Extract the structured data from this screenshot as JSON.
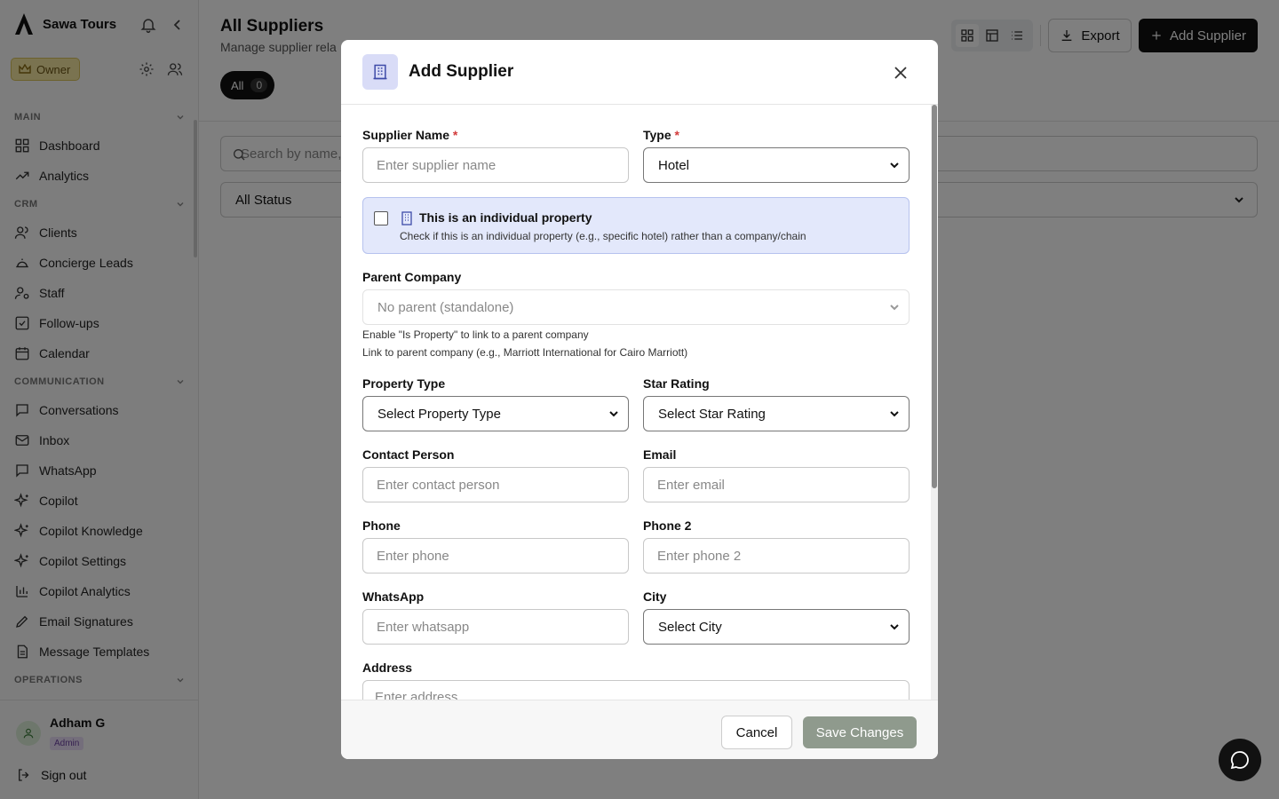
{
  "sidebar": {
    "brand": "Sawa Tours",
    "role_badge": "Owner",
    "sections": {
      "main": "MAIN",
      "crm": "CRM",
      "communication": "COMMUNICATION",
      "operations": "OPERATIONS"
    },
    "items": {
      "dashboard": "Dashboard",
      "analytics": "Analytics",
      "clients": "Clients",
      "concierge_leads": "Concierge Leads",
      "staff": "Staff",
      "follow_ups": "Follow-ups",
      "calendar": "Calendar",
      "conversations": "Conversations",
      "inbox": "Inbox",
      "whatsapp": "WhatsApp",
      "copilot": "Copilot",
      "copilot_knowledge": "Copilot Knowledge",
      "copilot_settings": "Copilot Settings",
      "copilot_analytics": "Copilot Analytics",
      "email_signatures": "Email Signatures",
      "message_templates": "Message Templates"
    },
    "user": {
      "name": "Adham G",
      "badge": "Admin"
    },
    "sign_out": "Sign out"
  },
  "page": {
    "title": "All Suppliers",
    "subtitle": "Manage supplier rela",
    "export_label": "Export",
    "add_label": "Add Supplier",
    "tab_all": {
      "label": "All",
      "count": "0"
    },
    "search_placeholder": "Search by name, e",
    "status_filter": "All Status"
  },
  "modal": {
    "title": "Add Supplier",
    "supplier_name": {
      "label": "Supplier Name",
      "required": "*",
      "placeholder": "Enter supplier name"
    },
    "type": {
      "label": "Type",
      "required": "*",
      "value": "Hotel"
    },
    "individual_property": {
      "label": "This is an individual property",
      "description": "Check if this is an individual property (e.g., specific hotel) rather than a company/chain"
    },
    "parent_company": {
      "label": "Parent Company",
      "value": "No parent (standalone)",
      "hint1": "Enable \"Is Property\" to link to a parent company",
      "hint2": "Link to parent company (e.g., Marriott International for Cairo Marriott)"
    },
    "property_type": {
      "label": "Property Type",
      "value": "Select Property Type"
    },
    "star_rating": {
      "label": "Star Rating",
      "value": "Select Star Rating"
    },
    "contact_person": {
      "label": "Contact Person",
      "placeholder": "Enter contact person"
    },
    "email": {
      "label": "Email",
      "placeholder": "Enter email"
    },
    "phone": {
      "label": "Phone",
      "placeholder": "Enter phone"
    },
    "phone2": {
      "label": "Phone 2",
      "placeholder": "Enter phone 2"
    },
    "whatsapp": {
      "label": "WhatsApp",
      "placeholder": "Enter whatsapp"
    },
    "city": {
      "label": "City",
      "value": "Select City"
    },
    "address": {
      "label": "Address",
      "placeholder": "Enter address"
    },
    "cancel_label": "Cancel",
    "save_label": "Save Changes"
  },
  "colors": {
    "accent": "#111111",
    "owner_badge": "#f4e7a0",
    "property_box": "#e3e8fb",
    "save_disabled": "#8f9a8d"
  }
}
